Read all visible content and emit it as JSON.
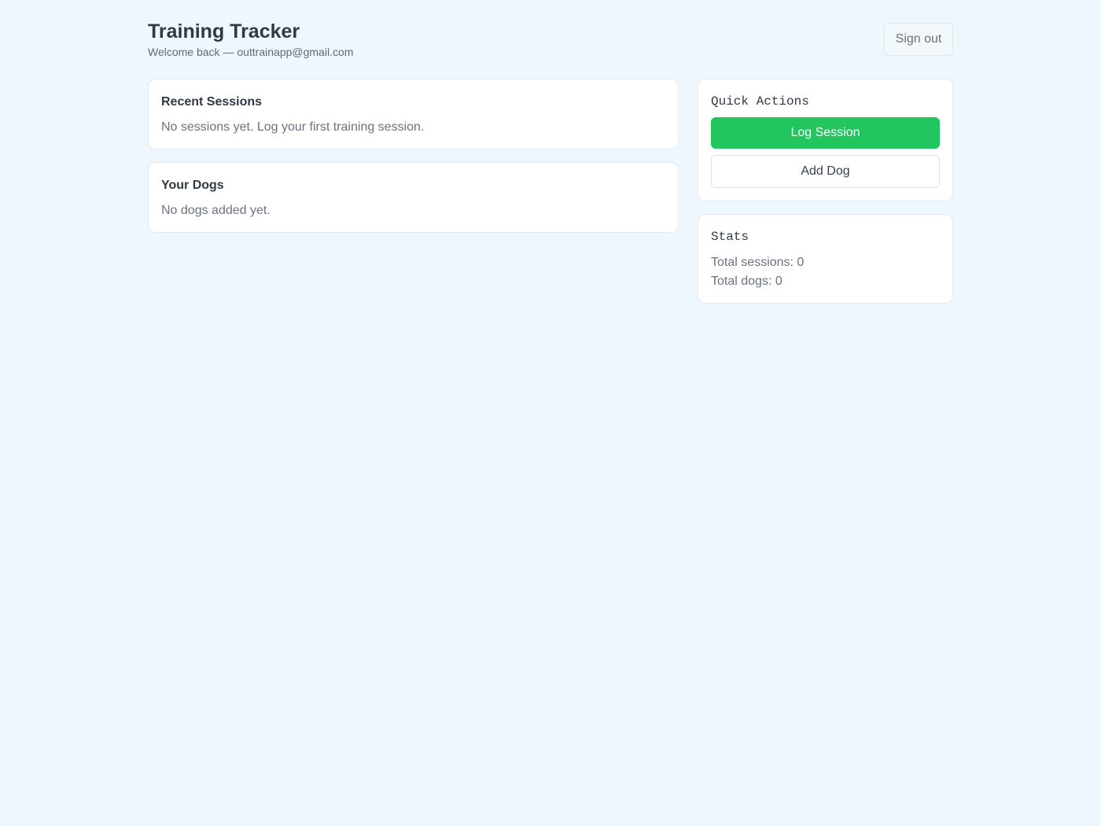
{
  "header": {
    "title": "Training Tracker",
    "welcome": "Welcome back — outtrainapp@gmail.com",
    "signout_label": "Sign out"
  },
  "recent_sessions": {
    "title": "Recent Sessions",
    "empty_text": "No sessions yet. Log your first training session."
  },
  "dogs": {
    "title": "Your Dogs",
    "empty_text": "No dogs added yet."
  },
  "quick_actions": {
    "title": "Quick Actions",
    "log_session_label": "Log Session",
    "add_dog_label": "Add Dog"
  },
  "stats": {
    "title": "Stats",
    "total_sessions": "Total sessions: 0",
    "total_dogs": "Total dogs: 0"
  },
  "colors": {
    "background": "#eff7fe",
    "primary": "#22c55e"
  }
}
